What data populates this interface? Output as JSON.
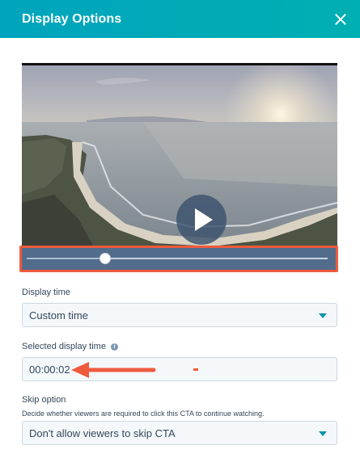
{
  "header": {
    "title": "Display Options"
  },
  "video": {
    "progress": 0.26
  },
  "display_time": {
    "label": "Display time",
    "value": "Custom time"
  },
  "selected_display_time": {
    "label": "Selected display time",
    "value": "00:00:02"
  },
  "skip_option": {
    "label": "Skip option",
    "help": "Decide whether viewers are required to click this CTA to continue watching.",
    "value": "Don't allow viewers to skip CTA"
  },
  "colors": {
    "header": "#00a4bd",
    "highlight": "#ef5a3d",
    "scrubber": "#526c8b",
    "accent": "#0091ae"
  },
  "icons": {
    "close": "close-icon",
    "play": "play-icon",
    "info": "info-icon",
    "caret": "chevron-down-icon",
    "annotation_arrow": "arrow-left-icon"
  }
}
